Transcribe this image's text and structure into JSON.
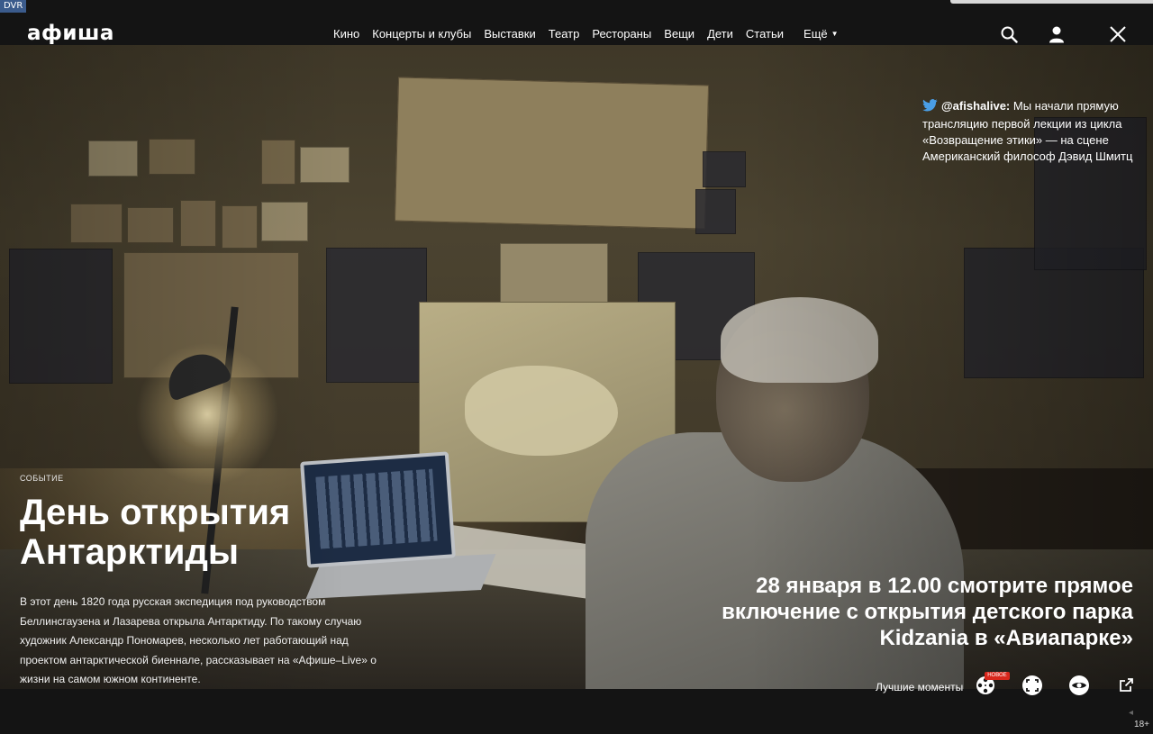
{
  "badge": {
    "dvr": "DVR"
  },
  "header": {
    "logo": "афиша",
    "nav": [
      {
        "label": "Кино"
      },
      {
        "label": "Концерты и клубы"
      },
      {
        "label": "Выставки"
      },
      {
        "label": "Театр"
      },
      {
        "label": "Рестораны"
      },
      {
        "label": "Вещи"
      },
      {
        "label": "Дети"
      },
      {
        "label": "Статьи"
      }
    ],
    "more_label": "Ещё",
    "icons": [
      "search-icon",
      "user-icon",
      "close-icon"
    ]
  },
  "tweet": {
    "handle": "@afishalive:",
    "text": "Мы начали прямую трансляцию первой лекции из цикла «Возвращение этики» — на сцене Американский философ Дэвид Шмитц"
  },
  "event": {
    "category": "Событие",
    "title": "День открытия Антарктиды",
    "description": "В этот день 1820 года русская экспедиция под руководством Беллинсгаузена и Лазарева открыла Антарктиду. По такому случаю художник Александр Пономарев, несколько лет работающий над проектом антарктической биеннале, рассказывает на «Афише–Live» о жизни на самом южном континенте."
  },
  "announcement": "28 января в 12.00 смотрите прямое включение с открытия детского парка Kidzania в «Авиапарке»",
  "controls": {
    "best_moments": "Лучшие моменты",
    "new_badge": "НОВОЕ",
    "icons": [
      "film-reel-icon",
      "fullscreen-icon",
      "eye-icon",
      "external-link-icon"
    ]
  },
  "age_rating": "18+",
  "colors": {
    "topbar": "#141414",
    "twitter": "#4a9ee6",
    "badge_red": "#d9271c",
    "dvr": "#3b5b8c"
  }
}
